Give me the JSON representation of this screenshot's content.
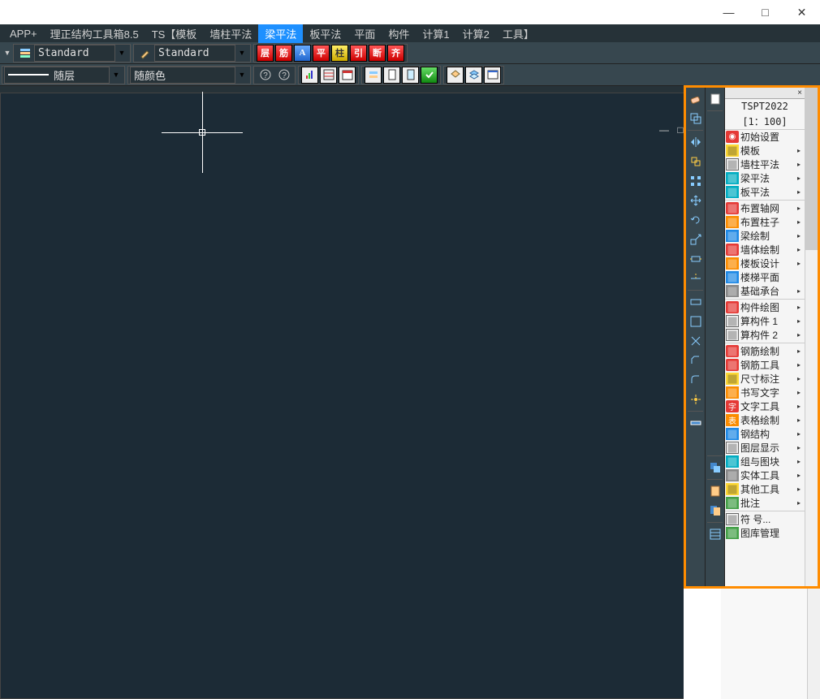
{
  "menu": {
    "items": [
      "APP+",
      "理正结构工具箱8.5",
      "TS【模板",
      "墙柱平法",
      "梁平法",
      "板平法",
      "平面",
      "构件",
      "计算1",
      "计算2",
      "工具】"
    ],
    "active_index": 4
  },
  "toolbar1": {
    "combo1": "Standard",
    "combo2": "Standard",
    "char_icons": [
      "层",
      "筋",
      "A",
      "平",
      "柱",
      "引",
      "断",
      "齐"
    ]
  },
  "toolbar2": {
    "linetype": "随层",
    "color": "随颜色"
  },
  "right_panel": {
    "title": "TSPT2022",
    "scale": "[1：100]",
    "items": [
      {
        "label": "初始设置",
        "icon": "gear",
        "color": "ic-red",
        "arrow": false
      },
      {
        "label": "模板",
        "icon": "tmpl",
        "color": "ic-yellow",
        "arrow": true
      },
      {
        "label": "墙柱平法",
        "icon": "grid",
        "color": "ic-border",
        "arrow": true
      },
      {
        "label": "梁平法",
        "icon": "beam",
        "color": "ic-cyan",
        "arrow": true
      },
      {
        "label": "板平法",
        "icon": "slab",
        "color": "ic-cyan",
        "arrow": true
      },
      {
        "sep": true
      },
      {
        "label": "布置轴网",
        "icon": "axis",
        "color": "ic-red",
        "arrow": true
      },
      {
        "label": "布置柱子",
        "icon": "col",
        "color": "ic-orange",
        "arrow": true
      },
      {
        "label": "梁绘制",
        "icon": "beam2",
        "color": "ic-blue",
        "arrow": true
      },
      {
        "label": "墙体绘制",
        "icon": "wall",
        "color": "ic-red",
        "arrow": true
      },
      {
        "label": "楼板设计",
        "icon": "floor",
        "color": "ic-orange",
        "arrow": true
      },
      {
        "label": "楼梯平面",
        "icon": "stair",
        "color": "ic-blue",
        "arrow": false
      },
      {
        "label": "基础承台",
        "icon": "found",
        "color": "ic-gray",
        "arrow": true
      },
      {
        "sep": true
      },
      {
        "label": "构件绘图",
        "icon": "comp",
        "color": "ic-red",
        "arrow": true
      },
      {
        "label": "算构件 1",
        "icon": "calc1",
        "color": "ic-border",
        "arrow": true
      },
      {
        "label": "算构件 2",
        "icon": "calc2",
        "color": "ic-border",
        "arrow": true
      },
      {
        "sep": true
      },
      {
        "label": "钢筋绘制",
        "icon": "rebar",
        "color": "ic-red",
        "arrow": true
      },
      {
        "label": "钢筋工具",
        "icon": "rtool",
        "color": "ic-red",
        "arrow": true
      },
      {
        "label": "尺寸标注",
        "icon": "dim",
        "color": "ic-yellow",
        "arrow": true
      },
      {
        "label": "书写文字",
        "icon": "text",
        "color": "ic-orange",
        "arrow": true
      },
      {
        "label": "文字工具",
        "icon": "字",
        "color": "ic-red",
        "arrow": true
      },
      {
        "label": "表格绘制",
        "icon": "表",
        "color": "ic-orange",
        "arrow": true
      },
      {
        "label": "钢结构",
        "icon": "steel",
        "color": "ic-blue",
        "arrow": true
      },
      {
        "label": "图层显示",
        "icon": "layer",
        "color": "ic-border",
        "arrow": true
      },
      {
        "label": "组与图块",
        "icon": "block",
        "color": "ic-cyan",
        "arrow": true
      },
      {
        "label": "实体工具",
        "icon": "ent",
        "color": "ic-gray",
        "arrow": true
      },
      {
        "label": "其他工具",
        "icon": "other",
        "color": "ic-yellow",
        "arrow": true
      },
      {
        "label": "批注",
        "icon": "note",
        "color": "ic-green",
        "arrow": true
      },
      {
        "sep": true
      },
      {
        "label": "符 号...",
        "icon": "sym",
        "color": "ic-border",
        "arrow": false
      },
      {
        "label": "图库管理",
        "icon": "lib",
        "color": "ic-green",
        "arrow": false
      }
    ]
  }
}
